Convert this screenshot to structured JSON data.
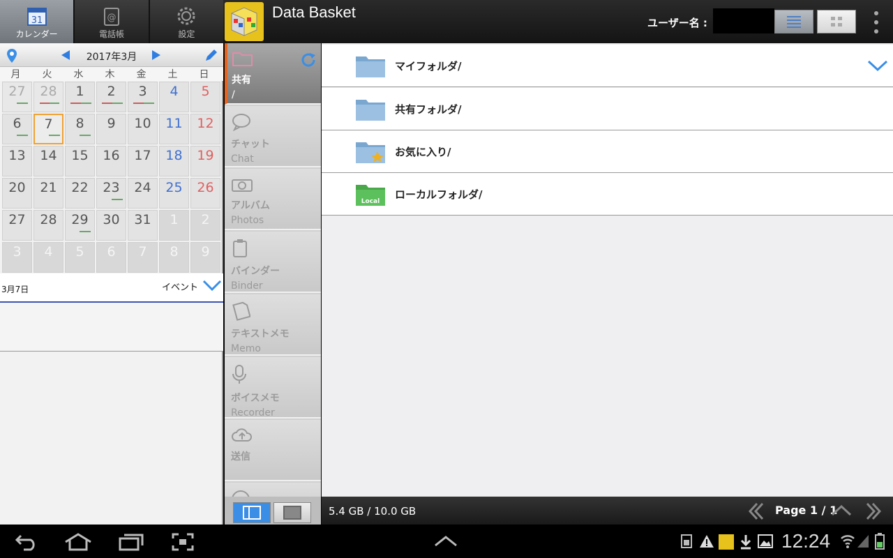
{
  "left_tabs": [
    {
      "label": "カレンダー",
      "icon": "calendar-icon",
      "icon_text": "31"
    },
    {
      "label": "電話帳",
      "icon": "address-book-icon"
    },
    {
      "label": "設定",
      "icon": "gear-icon"
    }
  ],
  "app": {
    "title": "Data Basket",
    "user_label": "ユーザー名 :"
  },
  "calendar": {
    "month": "2017年3月",
    "weekdays": [
      "月",
      "火",
      "水",
      "木",
      "金",
      "土",
      "日"
    ],
    "days": [
      "27",
      "28",
      "1",
      "2",
      "3",
      "4",
      "5",
      "6",
      "7",
      "8",
      "9",
      "10",
      "11",
      "12",
      "13",
      "14",
      "15",
      "16",
      "17",
      "18",
      "19",
      "20",
      "21",
      "22",
      "23",
      "24",
      "25",
      "26",
      "27",
      "28",
      "29",
      "30",
      "31",
      "1",
      "2",
      "3",
      "4",
      "5",
      "6",
      "7",
      "8",
      "9"
    ],
    "selected_date": "3月7日",
    "event_label": "イベント"
  },
  "nav": [
    {
      "ja": "共有",
      "en": "/"
    },
    {
      "ja": "チャット",
      "en": "Chat"
    },
    {
      "ja": "アルバム",
      "en": "Photos"
    },
    {
      "ja": "バインダー",
      "en": "Binder"
    },
    {
      "ja": "テキストメモ",
      "en": "Memo"
    },
    {
      "ja": "ボイスメモ",
      "en": "Recorder"
    },
    {
      "ja": "送信",
      "en": ""
    }
  ],
  "folders": [
    {
      "name": "マイフォルダ/",
      "icon": "folder-icon"
    },
    {
      "name": "共有フォルダ/",
      "icon": "folder-icon"
    },
    {
      "name": "お気に入り/",
      "icon": "favorite-folder-icon"
    },
    {
      "name": "ローカルフォルダ/",
      "icon": "local-folder-icon",
      "badge": "Local"
    }
  ],
  "footer": {
    "storage": "5.4 GB / 10.0 GB",
    "page": "Page 1 / 1"
  },
  "system": {
    "clock": "12:24"
  },
  "colors": {
    "accent": "#3a8ee6",
    "active_tab_orange": "#e8641e",
    "sat": "#3f6fd0",
    "sun": "#e06060"
  }
}
